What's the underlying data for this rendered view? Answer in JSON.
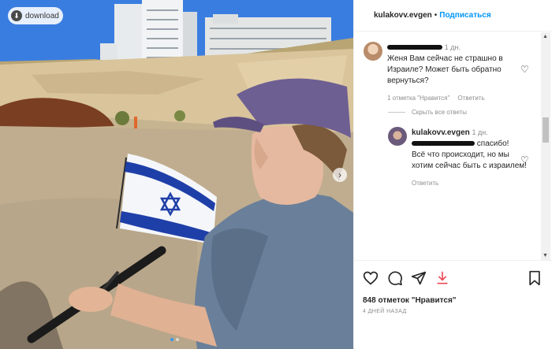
{
  "photo": {
    "download_label": "download",
    "next_icon": "chevron-right-icon",
    "slides": 2,
    "active_slide": 1
  },
  "header": {
    "username": "kulakovv.evgen",
    "separator": "•",
    "follow_label": "Подписаться"
  },
  "comments": [
    {
      "time": "1 дн.",
      "text": "Женя Вам сейчас не страшно в Израиле? Может быть обратно вернуться?",
      "likes": "1 отметка \"Нравится\"",
      "reply": "Ответить"
    }
  ],
  "hide_replies": "Скрыть все ответы",
  "reply": {
    "username": "kulakovv.evgen",
    "time": "1 дн.",
    "text_tail": "спасибо!",
    "text_rest": "Всё что происходит, но мы хотим сейчас быть с израилем!",
    "reply_label": "Ответить"
  },
  "footer": {
    "likes": "848 отметок \"Нравится\"",
    "date": "4 ДНЕЙ НАЗАД"
  },
  "colors": {
    "accent": "#0095f6",
    "download_red": "#ed4956",
    "text": "#262626",
    "secondary": "#8e8e8e"
  }
}
